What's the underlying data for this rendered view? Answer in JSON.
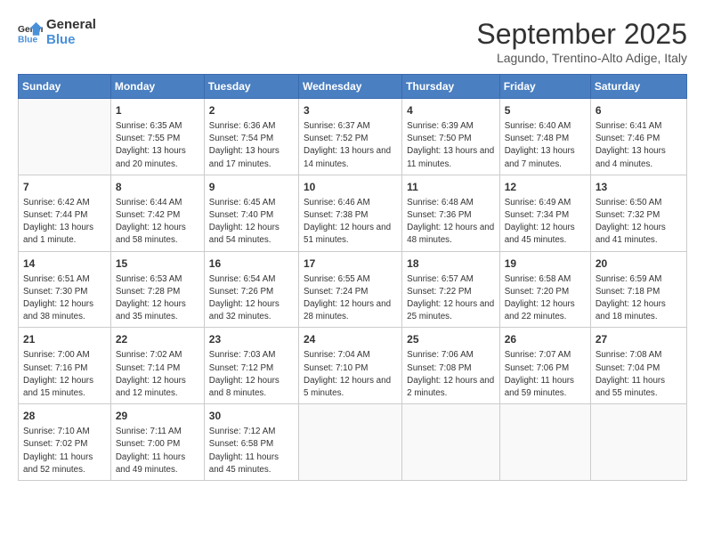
{
  "header": {
    "logo_line1": "General",
    "logo_line2": "Blue",
    "month": "September 2025",
    "location": "Lagundo, Trentino-Alto Adige, Italy"
  },
  "days_of_week": [
    "Sunday",
    "Monday",
    "Tuesday",
    "Wednesday",
    "Thursday",
    "Friday",
    "Saturday"
  ],
  "weeks": [
    [
      {
        "day": "",
        "sunrise": "",
        "sunset": "",
        "daylight": ""
      },
      {
        "day": "1",
        "sunrise": "Sunrise: 6:35 AM",
        "sunset": "Sunset: 7:55 PM",
        "daylight": "Daylight: 13 hours and 20 minutes."
      },
      {
        "day": "2",
        "sunrise": "Sunrise: 6:36 AM",
        "sunset": "Sunset: 7:54 PM",
        "daylight": "Daylight: 13 hours and 17 minutes."
      },
      {
        "day": "3",
        "sunrise": "Sunrise: 6:37 AM",
        "sunset": "Sunset: 7:52 PM",
        "daylight": "Daylight: 13 hours and 14 minutes."
      },
      {
        "day": "4",
        "sunrise": "Sunrise: 6:39 AM",
        "sunset": "Sunset: 7:50 PM",
        "daylight": "Daylight: 13 hours and 11 minutes."
      },
      {
        "day": "5",
        "sunrise": "Sunrise: 6:40 AM",
        "sunset": "Sunset: 7:48 PM",
        "daylight": "Daylight: 13 hours and 7 minutes."
      },
      {
        "day": "6",
        "sunrise": "Sunrise: 6:41 AM",
        "sunset": "Sunset: 7:46 PM",
        "daylight": "Daylight: 13 hours and 4 minutes."
      }
    ],
    [
      {
        "day": "7",
        "sunrise": "Sunrise: 6:42 AM",
        "sunset": "Sunset: 7:44 PM",
        "daylight": "Daylight: 13 hours and 1 minute."
      },
      {
        "day": "8",
        "sunrise": "Sunrise: 6:44 AM",
        "sunset": "Sunset: 7:42 PM",
        "daylight": "Daylight: 12 hours and 58 minutes."
      },
      {
        "day": "9",
        "sunrise": "Sunrise: 6:45 AM",
        "sunset": "Sunset: 7:40 PM",
        "daylight": "Daylight: 12 hours and 54 minutes."
      },
      {
        "day": "10",
        "sunrise": "Sunrise: 6:46 AM",
        "sunset": "Sunset: 7:38 PM",
        "daylight": "Daylight: 12 hours and 51 minutes."
      },
      {
        "day": "11",
        "sunrise": "Sunrise: 6:48 AM",
        "sunset": "Sunset: 7:36 PM",
        "daylight": "Daylight: 12 hours and 48 minutes."
      },
      {
        "day": "12",
        "sunrise": "Sunrise: 6:49 AM",
        "sunset": "Sunset: 7:34 PM",
        "daylight": "Daylight: 12 hours and 45 minutes."
      },
      {
        "day": "13",
        "sunrise": "Sunrise: 6:50 AM",
        "sunset": "Sunset: 7:32 PM",
        "daylight": "Daylight: 12 hours and 41 minutes."
      }
    ],
    [
      {
        "day": "14",
        "sunrise": "Sunrise: 6:51 AM",
        "sunset": "Sunset: 7:30 PM",
        "daylight": "Daylight: 12 hours and 38 minutes."
      },
      {
        "day": "15",
        "sunrise": "Sunrise: 6:53 AM",
        "sunset": "Sunset: 7:28 PM",
        "daylight": "Daylight: 12 hours and 35 minutes."
      },
      {
        "day": "16",
        "sunrise": "Sunrise: 6:54 AM",
        "sunset": "Sunset: 7:26 PM",
        "daylight": "Daylight: 12 hours and 32 minutes."
      },
      {
        "day": "17",
        "sunrise": "Sunrise: 6:55 AM",
        "sunset": "Sunset: 7:24 PM",
        "daylight": "Daylight: 12 hours and 28 minutes."
      },
      {
        "day": "18",
        "sunrise": "Sunrise: 6:57 AM",
        "sunset": "Sunset: 7:22 PM",
        "daylight": "Daylight: 12 hours and 25 minutes."
      },
      {
        "day": "19",
        "sunrise": "Sunrise: 6:58 AM",
        "sunset": "Sunset: 7:20 PM",
        "daylight": "Daylight: 12 hours and 22 minutes."
      },
      {
        "day": "20",
        "sunrise": "Sunrise: 6:59 AM",
        "sunset": "Sunset: 7:18 PM",
        "daylight": "Daylight: 12 hours and 18 minutes."
      }
    ],
    [
      {
        "day": "21",
        "sunrise": "Sunrise: 7:00 AM",
        "sunset": "Sunset: 7:16 PM",
        "daylight": "Daylight: 12 hours and 15 minutes."
      },
      {
        "day": "22",
        "sunrise": "Sunrise: 7:02 AM",
        "sunset": "Sunset: 7:14 PM",
        "daylight": "Daylight: 12 hours and 12 minutes."
      },
      {
        "day": "23",
        "sunrise": "Sunrise: 7:03 AM",
        "sunset": "Sunset: 7:12 PM",
        "daylight": "Daylight: 12 hours and 8 minutes."
      },
      {
        "day": "24",
        "sunrise": "Sunrise: 7:04 AM",
        "sunset": "Sunset: 7:10 PM",
        "daylight": "Daylight: 12 hours and 5 minutes."
      },
      {
        "day": "25",
        "sunrise": "Sunrise: 7:06 AM",
        "sunset": "Sunset: 7:08 PM",
        "daylight": "Daylight: 12 hours and 2 minutes."
      },
      {
        "day": "26",
        "sunrise": "Sunrise: 7:07 AM",
        "sunset": "Sunset: 7:06 PM",
        "daylight": "Daylight: 11 hours and 59 minutes."
      },
      {
        "day": "27",
        "sunrise": "Sunrise: 7:08 AM",
        "sunset": "Sunset: 7:04 PM",
        "daylight": "Daylight: 11 hours and 55 minutes."
      }
    ],
    [
      {
        "day": "28",
        "sunrise": "Sunrise: 7:10 AM",
        "sunset": "Sunset: 7:02 PM",
        "daylight": "Daylight: 11 hours and 52 minutes."
      },
      {
        "day": "29",
        "sunrise": "Sunrise: 7:11 AM",
        "sunset": "Sunset: 7:00 PM",
        "daylight": "Daylight: 11 hours and 49 minutes."
      },
      {
        "day": "30",
        "sunrise": "Sunrise: 7:12 AM",
        "sunset": "Sunset: 6:58 PM",
        "daylight": "Daylight: 11 hours and 45 minutes."
      },
      {
        "day": "",
        "sunrise": "",
        "sunset": "",
        "daylight": ""
      },
      {
        "day": "",
        "sunrise": "",
        "sunset": "",
        "daylight": ""
      },
      {
        "day": "",
        "sunrise": "",
        "sunset": "",
        "daylight": ""
      },
      {
        "day": "",
        "sunrise": "",
        "sunset": "",
        "daylight": ""
      }
    ]
  ]
}
